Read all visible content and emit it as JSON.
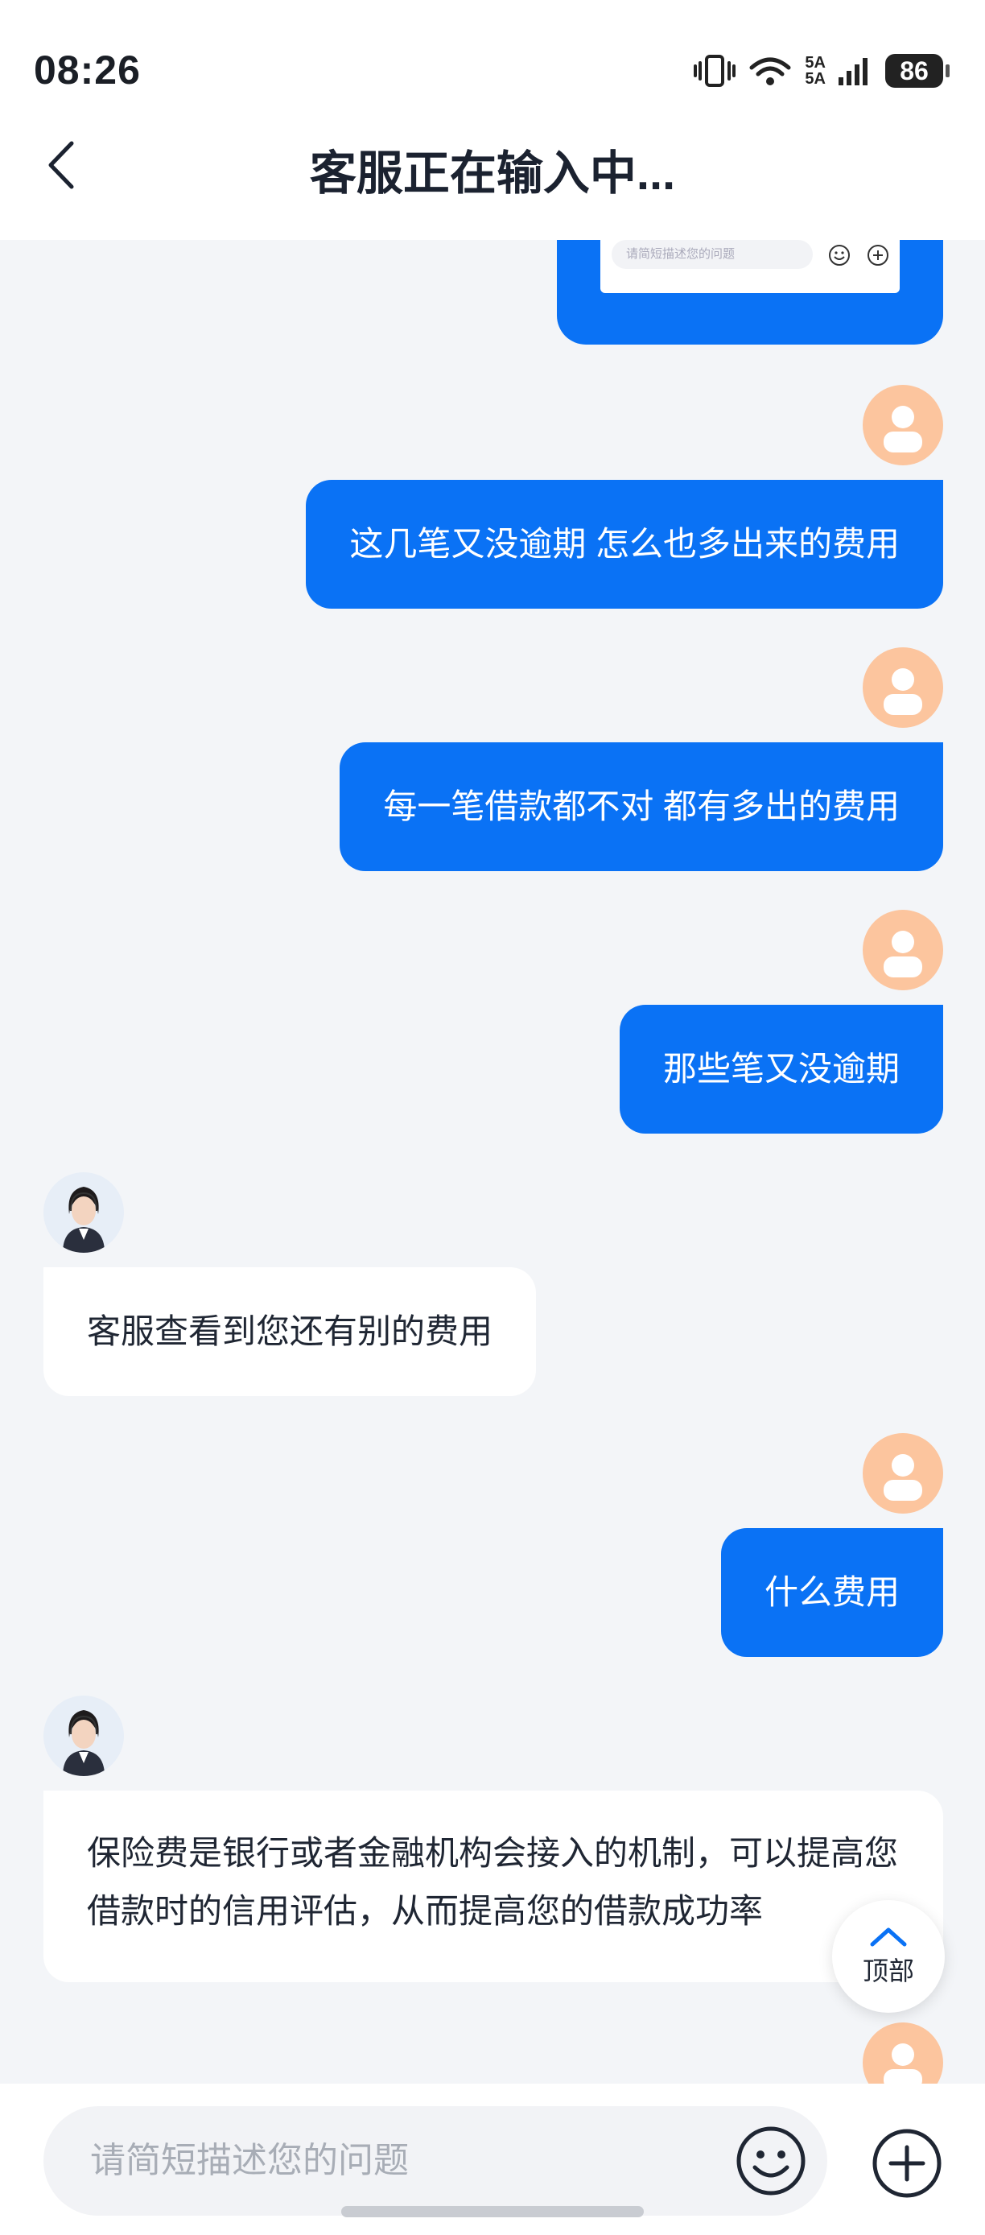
{
  "status_bar": {
    "time": "08:26",
    "battery": "86",
    "network_top": "5A",
    "network_bottom": "5A",
    "wifi_label": "6"
  },
  "header": {
    "title": "客服正在输入中...",
    "back_icon": "chevron-left-icon"
  },
  "preview_image": {
    "input_placeholder": "请简短描述您的问题"
  },
  "messages": [
    {
      "role": "user",
      "text": "这几笔又没逾期 怎么也多出来的费用"
    },
    {
      "role": "user",
      "text": "每一笔借款都不对 都有多出的费用"
    },
    {
      "role": "user",
      "text": "那些笔又没逾期"
    },
    {
      "role": "agent",
      "text": "客服查看到您还有别的费用"
    },
    {
      "role": "user",
      "text": "什么费用"
    },
    {
      "role": "agent",
      "text": "保险费是银行或者金融机构会接入的机制，可以提高您借款时的信用评估，从而提高您的借款成功率"
    }
  ],
  "top_button": {
    "label": "顶部"
  },
  "input_bar": {
    "placeholder": "请简短描述您的问题",
    "emoji_icon": "smiley-icon",
    "plus_icon": "plus-circle-icon"
  },
  "colors": {
    "accent": "#0a72f5",
    "user_avatar": "#fcc59e",
    "background": "#f3f5f8"
  }
}
